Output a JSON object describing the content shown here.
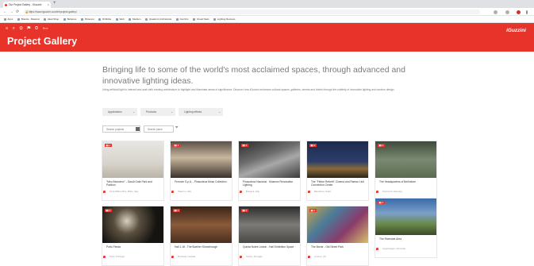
{
  "browser": {
    "tab_title": "Our Project Gallery - iGuzzini",
    "tab_close": "×",
    "new_tab": "+",
    "url": "https://www.iguzzini.com/int/project-gallery/",
    "nav": {
      "back": "←",
      "forward": "→",
      "reload": "⟳"
    },
    "bookmarks": [
      "Apps",
      "Brands - Material",
      "Ideal Shop",
      "Behance",
      "Pinterest",
      "Dribbble",
      "Web",
      "Medium",
      "Quaderni Architettura",
      "iGuzzini",
      "Visual Stats",
      "Lighting Reviews"
    ]
  },
  "header": {
    "icons": "≡ ⌕ ⚙ ⚑ ◎",
    "more": "More",
    "title": "Project Gallery",
    "logo": "iGuzzini"
  },
  "intro": {
    "headline": "Bringing life to some of the world's most acclaimed spaces, through advanced and innovative lighting ideas.",
    "text": "Using artificial light to interact and work with existing architecture to highlight and illuminate areas of significance. Discover how iGuzzini enhances cultural spaces, galleries, streets and hotels through the subtlety of innovative lighting and modern design."
  },
  "filters": [
    {
      "label": "Applications",
      "chevron": "⌄"
    },
    {
      "label": "Products",
      "chevron": "⌄"
    },
    {
      "label": "Lighting effects",
      "chevron": "⌄"
    }
  ],
  "search": {
    "project_placeholder": "Search projects",
    "location_placeholder": "Search place"
  },
  "cards": [
    {
      "badge": "▮▮ ♦",
      "title": "\"Miro Beurdeux\" - Gaudi Gate Park and Pavilion",
      "meta": "Fiera Milano Rho, Milan, Italy"
    },
    {
      "badge": "▮▮ ♦",
      "title": "Ferrovie S.p.A. - Pinacoteca Muse Collection",
      "meta": "Palermo, Italy"
    },
    {
      "badge": "▮▮ ♦",
      "title": "Pinacoteca Nacional - Museum Renovation Lighting",
      "meta": "Bologna, Italy"
    },
    {
      "badge": "▮▮ ♦",
      "title": "The \"Fiebre Rebeth\" Cinema and Ramon Llull Convention Center",
      "meta": "Barcelona, Spain"
    },
    {
      "badge": "▮▮ ♦",
      "title": "The Headquarters of Berlinform",
      "meta": "Dortmund, Germany"
    },
    {
      "badge": "▮▮ ♦",
      "title": "Porto Fiesta",
      "meta": "Porto, Portugal"
    },
    {
      "badge": "▮▮ ♦",
      "title": "Hall 1.18 - The Buehler Showthrough",
      "meta": "Montreal, Canada"
    },
    {
      "badge": "▮▮ ♦",
      "title": "Quinta Nobre Lisbon - Hall Exhibition Space",
      "meta": "Lisbon, Portugal"
    },
    {
      "badge": "▮▮ ♦",
      "title": "The Movie - Old Street Park",
      "meta": "London, UK"
    },
    {
      "badge": "▮▮ ♦",
      "title": "The Riverside Area",
      "meta": "Copenhagen, Denmark"
    }
  ],
  "colors": {
    "brand_red": "#e8332a",
    "headline_gray": "#7a7a7a",
    "filter_bg": "#efefef"
  }
}
